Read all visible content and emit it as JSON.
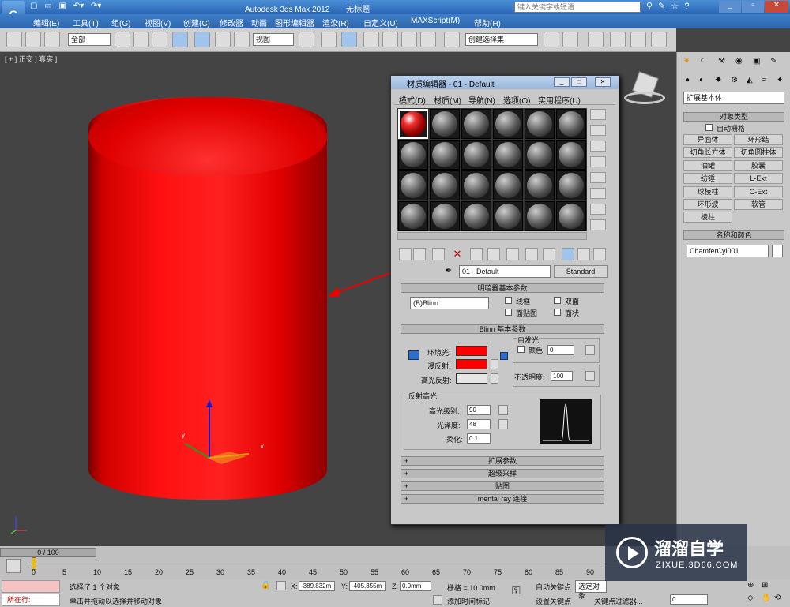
{
  "titlebar": {
    "app": "Autodesk 3ds Max  2012",
    "doc": "无标题",
    "search_placeholder": "键入关键字或短语"
  },
  "menubar": {
    "items": [
      "编辑(E)",
      "工具(T)",
      "组(G)",
      "视图(V)",
      "创建(C)",
      "修改器",
      "动画",
      "图形编辑器",
      "渲染(R)",
      "自定义(U)",
      "MAXScript(M)",
      "帮助(H)"
    ]
  },
  "toolbar": {
    "selection_filter": "全部",
    "ref_coord": "视图",
    "named_selection": "创建选择集"
  },
  "viewport": {
    "label": "[ + ] 正交 ] 真实 ]"
  },
  "material_editor": {
    "title": "材质编辑器 - 01 - Default",
    "menu": [
      "模式(D)",
      "材质(M)",
      "导航(N)",
      "选项(O)",
      "实用程序(U)"
    ],
    "material_name": "01 - Default",
    "material_type": "Standard",
    "shader_rollout": "明暗器基本参数",
    "shader": "(B)Blinn",
    "shader_checks": [
      "线框",
      "双面",
      "面贴图",
      "面状"
    ],
    "blinn_rollout": "Blinn 基本参数",
    "self_illum": "自发光",
    "self_illum_color_label": "颜色",
    "self_illum_value": "0",
    "ambient_label": "环境光:",
    "diffuse_label": "漫反射:",
    "specular_label": "高光反射:",
    "opacity_label": "不透明度:",
    "opacity_value": "100",
    "spec_group": "反射高光",
    "spec_level_label": "高光级别:",
    "spec_level": "90",
    "gloss_label": "光泽度:",
    "gloss": "48",
    "soften_label": "柔化:",
    "soften": "0.1",
    "rollouts": [
      "扩展参数",
      "超级采样",
      "贴图",
      "mental ray 连接"
    ],
    "colors": {
      "ambient": "#ff0000",
      "diffuse": "#ff0000",
      "specular": "#e6e6e6"
    }
  },
  "command_panel": {
    "category": "扩展基本体",
    "object_type_title": "对象类型",
    "autogrid": "自动栅格",
    "buttons": [
      "异面体",
      "环形结",
      "切角长方体",
      "切角圆柱体",
      "油罐",
      "胶囊",
      "纺锤",
      "L-Ext",
      "球棱柱",
      "C-Ext",
      "环形波",
      "软管",
      "棱柱"
    ],
    "name_color_title": "名称和颜色",
    "object_name": "ChamferCyl001"
  },
  "timeline": {
    "frame": "0 / 100",
    "ticks": [
      "0",
      "5",
      "10",
      "15",
      "20",
      "25",
      "30",
      "35",
      "40",
      "45",
      "50",
      "55",
      "60",
      "65",
      "70",
      "75",
      "80",
      "85",
      "90"
    ]
  },
  "status": {
    "selected": "选择了 1 个对象",
    "prompt": "单击并拖动以选择并移动对象",
    "x": "-389.832m",
    "y": "-405.355m",
    "z": "0.0mm",
    "grid": "栅格 = 10.0mm",
    "add_time_tag": "添加时间标记",
    "autokey": "自动关键点",
    "selected_obj": "选定对象",
    "setkey": "设置关键点",
    "key_filter": "关键点过滤器...",
    "frame_value": "0",
    "script_label": "所在行:",
    "x_label": "X:",
    "y_label": "Y:",
    "z_label": "Z:"
  },
  "watermark": {
    "brand": "溜溜自学",
    "url": "ZIXUE.3D66.COM"
  }
}
